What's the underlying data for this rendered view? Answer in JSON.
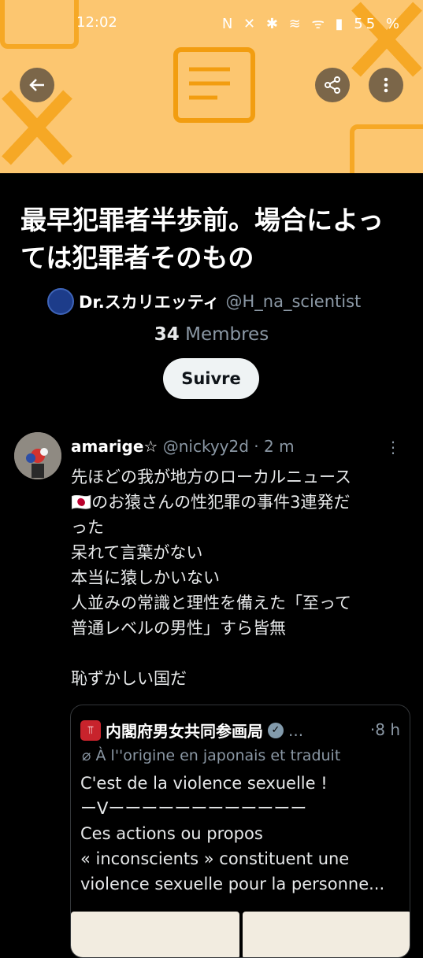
{
  "status_bar": {
    "time": "12:02",
    "icons": "N ✕ ✱ ≋ ᯤ ▮",
    "battery": "55 %"
  },
  "header": {
    "back_icon": "arrow-left-icon",
    "share_icon": "share-icon",
    "more_icon": "more-vertical-icon"
  },
  "list": {
    "title": "最早犯罪者半歩前。場合によっては犯罪者そのもの",
    "owner_name": "Dr.スカリエッティ",
    "owner_handle": "@H_na_scientist",
    "member_count": "34",
    "member_label": "Membres",
    "follow_label": "Suivre"
  },
  "post": {
    "author_name": "amarige☆",
    "author_handle": "@nickyy2d",
    "time": "2 m",
    "lines": [
      "先ほどの我が地方のローカルニュース",
      "🇯🇵のお猿さんの性犯罪の事件3連発だ",
      "った",
      "呆れて言葉がない",
      "本当に猿しかいない",
      "人並みの常識と理性を備えた「至って",
      "普通レベルの男性」すら皆無",
      "",
      "恥ずかしい国だ"
    ],
    "quote": {
      "author_name": "内閣府男女共同参画局",
      "ellipsis": "...",
      "time": "8 h",
      "translation_note": "À l''origine en japonais et traduit",
      "lines": [
        "C'est de la violence sexuelle !",
        "ーVーーーーーーーーーーーー",
        "Ces actions ou propos",
        "« inconscients » constituent une",
        "violence sexuelle pour la personne..."
      ]
    }
  }
}
